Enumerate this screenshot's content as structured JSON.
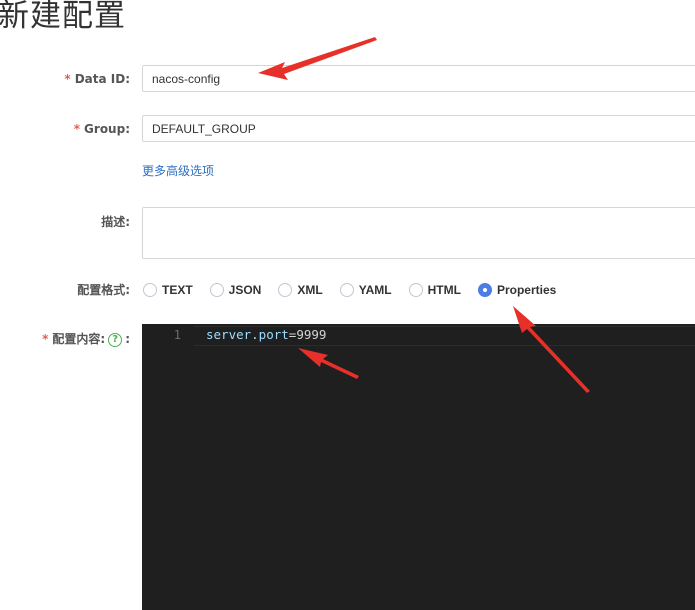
{
  "page": {
    "title": "新建配置"
  },
  "form": {
    "data_id": {
      "label": "Data ID:",
      "value": "nacos-config"
    },
    "group": {
      "label": "Group:",
      "value": "DEFAULT_GROUP"
    },
    "advanced_link": "更多高级选项",
    "description": {
      "label": "描述:",
      "value": ""
    },
    "format": {
      "label": "配置格式:",
      "options": [
        "TEXT",
        "JSON",
        "XML",
        "YAML",
        "HTML",
        "Properties"
      ],
      "selected": "Properties"
    },
    "content": {
      "label": "配置内容:",
      "help_glyph": "?",
      "label_suffix": ":",
      "lines": [
        {
          "number": "1",
          "key": "server.port",
          "op": "=",
          "value": "9999"
        }
      ]
    }
  },
  "annotations": {
    "arrow_color": "#e8302a"
  },
  "required_mark": "*"
}
